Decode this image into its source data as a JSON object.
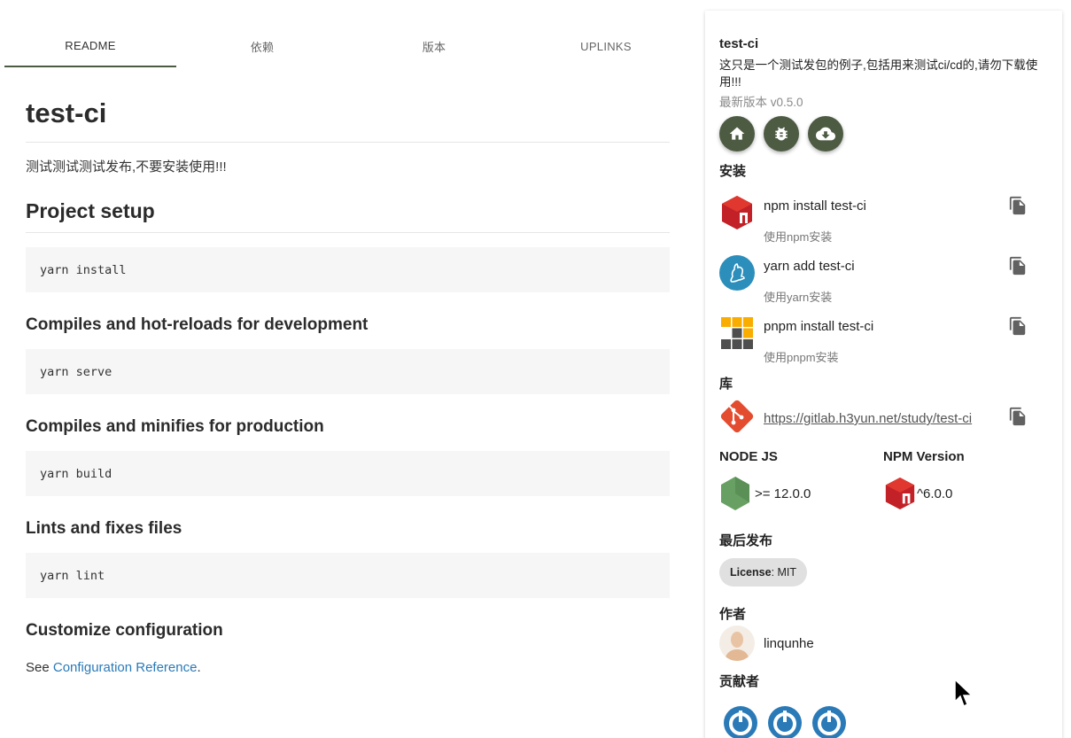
{
  "tabs": [
    {
      "label": "README",
      "active": true
    },
    {
      "label": "依赖",
      "active": false
    },
    {
      "label": "版本",
      "active": false
    },
    {
      "label": "UPLINKS",
      "active": false
    }
  ],
  "readme": {
    "title": "test-ci",
    "description": "测试测试测试发布,不要安装使用!!!",
    "setup_heading": "Project setup",
    "setup_code": "yarn install",
    "dev_heading": "Compiles and hot-reloads for development",
    "dev_code": "yarn serve",
    "prod_heading": "Compiles and minifies for production",
    "prod_code": "yarn build",
    "lint_heading": "Lints and fixes files",
    "lint_code": "yarn lint",
    "config_heading": "Customize configuration",
    "see_prefix": "See ",
    "config_link": "Configuration Reference",
    "see_suffix": "."
  },
  "sidebar": {
    "package_name": "test-ci",
    "package_desc": "这只是一个测试发包的例子,包括用来测试ci/cd的,请勿下载使用!!!",
    "latest_version": "最新版本 v0.5.0",
    "install_label": "安装",
    "installs": [
      {
        "cmd": "npm install test-ci",
        "sub": "使用npm安装",
        "icon": "npm-icon"
      },
      {
        "cmd": "yarn add test-ci",
        "sub": "使用yarn安装",
        "icon": "yarn-icon"
      },
      {
        "cmd": "pnpm install test-ci",
        "sub": "使用pnpm安装",
        "icon": "pnpm-icon"
      }
    ],
    "repo_label": "库",
    "repo_url": "https://gitlab.h3yun.net/study/test-ci",
    "node_label": "NODE JS",
    "node_value": ">= 12.0.0",
    "npm_label": "NPM Version",
    "npm_value": "^6.0.0",
    "last_publish_label": "最后发布",
    "license_key": "License",
    "license_value": ": MIT",
    "author_label": "作者",
    "author_name": "linqunhe",
    "contrib_label": "贡献者"
  },
  "colors": {
    "accent": "#4d5b43",
    "npm_red": "#c12127",
    "yarn_blue": "#2c8ebb",
    "git_orange": "#e44c30",
    "node_green": "#68a063",
    "link_blue": "#2a7ab8"
  }
}
